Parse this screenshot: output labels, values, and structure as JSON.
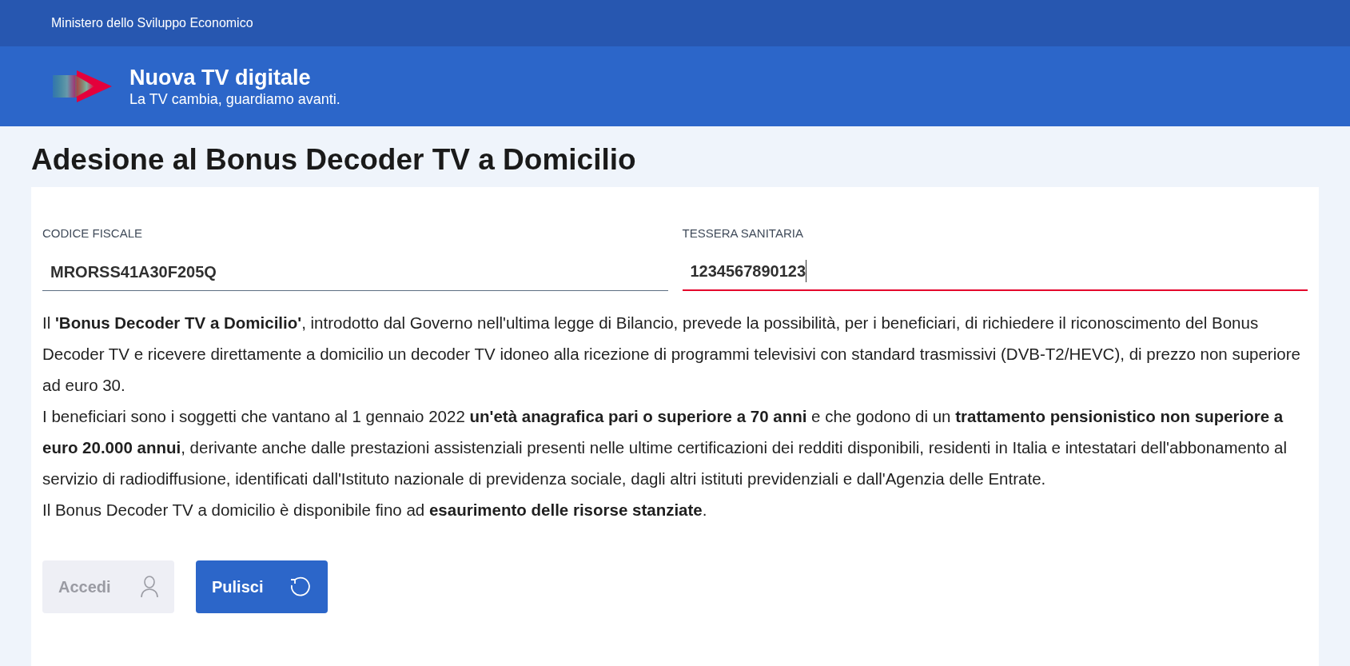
{
  "top_bar": {
    "title": "Ministero dello Sviluppo Economico"
  },
  "header": {
    "title": "Nuova TV digitale",
    "subtitle": "La TV cambia, guardiamo avanti."
  },
  "page_title": "Adesione al Bonus Decoder TV a Domicilio",
  "fields": [
    {
      "label": "CODICE FISCALE",
      "value": "MRORSS41A30F205Q",
      "invalid": false,
      "focused": false
    },
    {
      "label": "TESSERA SANITARIA",
      "value": "1234567890123",
      "invalid": true,
      "focused": true
    }
  ],
  "paragraphs": [
    "Il **'Bonus Decoder TV a Domicilio'**, introdotto dal Governo nell'ultima legge di Bilancio, prevede la possibilità, per i beneficiari, di richiedere il riconoscimento del Bonus Decoder TV e ricevere direttamente a domicilio un decoder TV idoneo alla ricezione di programmi televisivi con standard trasmissivi (DVB-T2/HEVC), di prezzo non superiore ad euro 30.",
    "I beneficiari sono i soggetti che vantano al 1 gennaio 2022 **un'età anagrafica pari o superiore a 70 anni** e che godono di un **trattamento pensionistico non superiore a euro 20.000 annui**, derivante anche dalle prestazioni assistenziali presenti nelle ultime certificazioni dei redditi disponibili, residenti in Italia e intestatari dell'abbonamento al servizio di radiodiffusione, identificati dall'Istituto nazionale di previdenza sociale, dagli altri istituti previdenziali e dall'Agenzia delle Entrate.",
    "Il Bonus Decoder TV a domicilio è disponibile fino ad **esaurimento delle risorse stanziate**."
  ],
  "buttons": [
    {
      "label": "Accedi",
      "kind": "login",
      "disabled": true
    },
    {
      "label": "Pulisci",
      "kind": "reset",
      "disabled": false
    }
  ]
}
